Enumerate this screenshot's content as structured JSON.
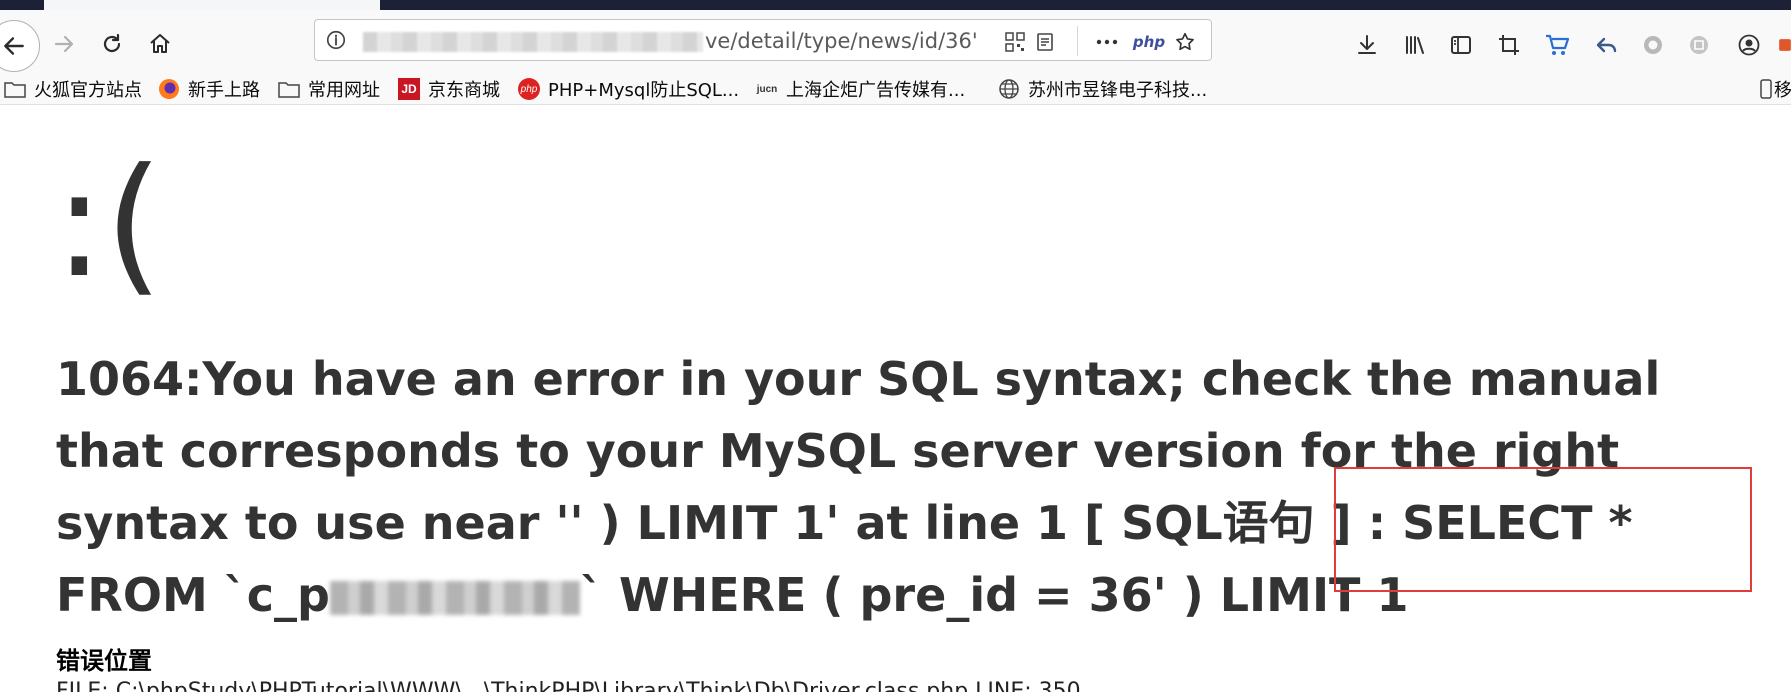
{
  "url": {
    "visible_suffix": "ve/detail/type/news/id/36'",
    "php_label": "php"
  },
  "bookmarks": [
    {
      "label": "火狐官方站点",
      "icon": "folder-icon"
    },
    {
      "label": "新手上路",
      "icon": "firefox-icon"
    },
    {
      "label": "常用网址",
      "icon": "folder-icon"
    },
    {
      "label": "京东商城",
      "icon": "jd-icon",
      "icon_text": "JD"
    },
    {
      "label": "PHP+Mysql防止SQL...",
      "icon": "php-icon",
      "icon_text": "php"
    },
    {
      "label": "上海企炬广告传媒有...",
      "icon": "juca-icon",
      "icon_text": "jucn"
    },
    {
      "label": "苏州市昱锋电子科技...",
      "icon": "globe-icon"
    },
    {
      "label": "移",
      "icon": "mobile-icon"
    }
  ],
  "error": {
    "face": ":(",
    "message_before_mask": "1064:You have an error in your SQL syntax; check the manual that corresponds to your MySQL server version for the right syntax to use near '' ) LIMIT 1' at line 1 [ SQL语句 ] : SELECT * FROM `c_p",
    "message_after_mask": "` WHERE ( pre_id = 36' ) LIMIT 1",
    "position_title": "错误位置",
    "file_line": "FILE: C:\\phpStudy\\PHPTutorial\\WWW\\...\\ThinkPHP\\Library\\Think\\Db\\Driver.class.php LINE: 350"
  },
  "colors": {
    "highlight_border": "#e03c3c",
    "text": "#333333"
  }
}
